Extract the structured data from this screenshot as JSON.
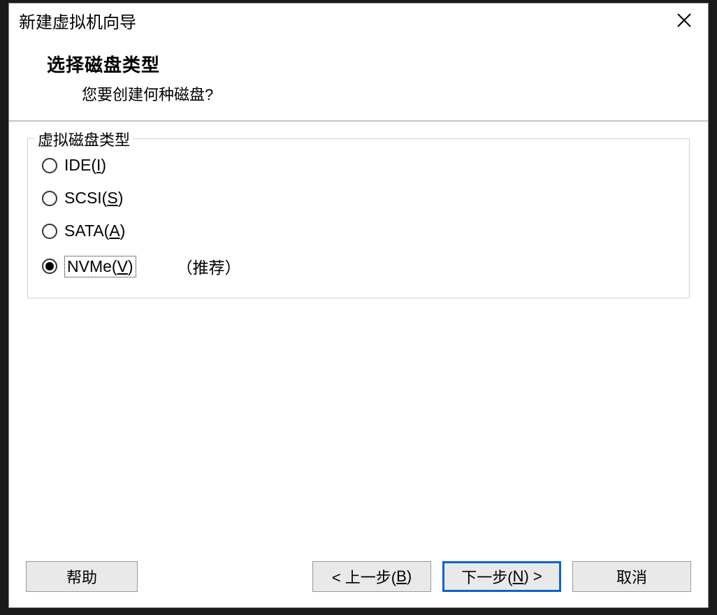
{
  "window": {
    "title": "新建虚拟机向导"
  },
  "header": {
    "title": "选择磁盘类型",
    "subtitle": "您要创建何种磁盘?"
  },
  "fieldset": {
    "legend": "虚拟磁盘类型"
  },
  "options": {
    "ide": {
      "label_pre": "IDE(",
      "key": "I",
      "label_post": ")",
      "checked": false
    },
    "scsi": {
      "label_pre": "SCSI(",
      "key": "S",
      "label_post": ")",
      "checked": false
    },
    "sata": {
      "label_pre": "SATA(",
      "key": "A",
      "label_post": ")",
      "checked": false
    },
    "nvme": {
      "label_pre": "NVMe(",
      "key": "V",
      "label_post": ")",
      "checked": true,
      "note": "（推荐）"
    }
  },
  "buttons": {
    "help": "帮助",
    "back_pre": "< 上一步(",
    "back_key": "B",
    "back_post": ")",
    "next_pre": "下一步(",
    "next_key": "N",
    "next_post": ") >",
    "cancel": "取消"
  }
}
